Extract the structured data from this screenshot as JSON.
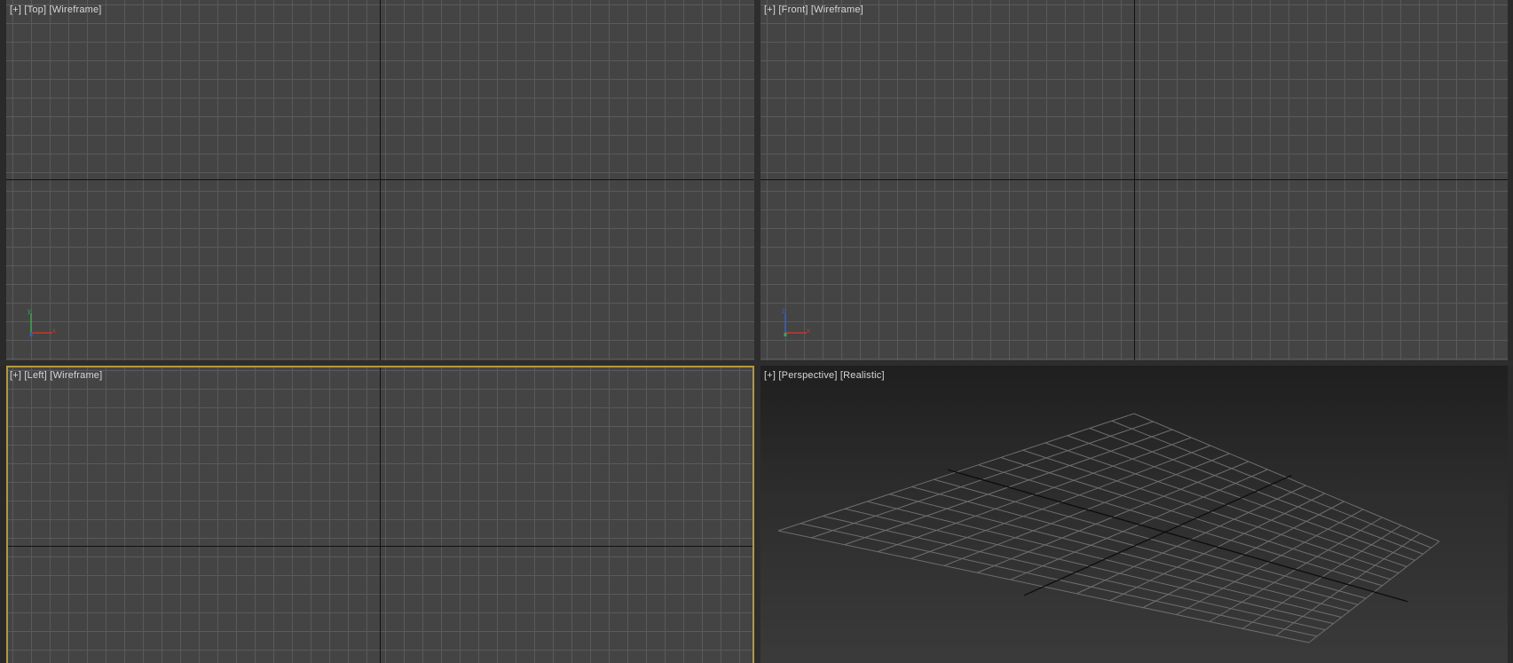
{
  "viewports": {
    "top": {
      "plus": "[+]",
      "view": "[Top]",
      "shading": "[Wireframe]"
    },
    "front": {
      "plus": "[+]",
      "view": "[Front]",
      "shading": "[Wireframe]"
    },
    "left": {
      "plus": "[+]",
      "view": "[Left]",
      "shading": "[Wireframe]"
    },
    "perspective": {
      "plus": "[+]",
      "view": "[Perspective]",
      "shading": "[Realistic]"
    }
  },
  "gizmos": {
    "top": {
      "axis1": "y",
      "axis2": "x"
    },
    "front": {
      "axis1": "z",
      "axis2": "x"
    }
  },
  "colors": {
    "active_viewport_border": "#b49a3a",
    "grid_line": "#5a5a5a",
    "axis_line": "#111111",
    "x_axis": "#c0392b",
    "y_axis": "#3fa34d",
    "z_axis": "#2f5fd0"
  },
  "active_viewport": "left"
}
